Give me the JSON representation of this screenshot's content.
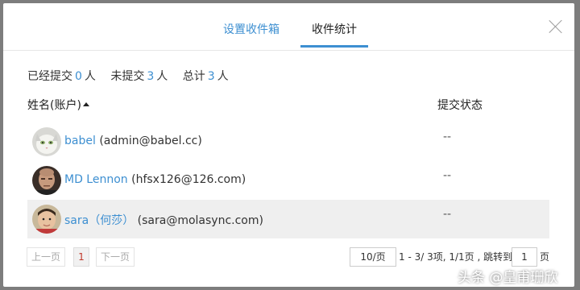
{
  "modal": {
    "tabs": [
      {
        "label": "设置收件箱",
        "active": false
      },
      {
        "label": "收件统计",
        "active": true
      }
    ]
  },
  "summary": {
    "submitted_label": "已经提交",
    "submitted_count": "0",
    "unsubmitted_label": "未提交",
    "unsubmitted_count": "3",
    "total_label": "总计",
    "total_count": "3",
    "unit": "人"
  },
  "table": {
    "headers": {
      "name": "姓名(账户)",
      "status": "提交状态"
    },
    "rows": [
      {
        "name": "babel",
        "account": "(admin@babel.cc)",
        "status": "--",
        "avatar": "cat-icon"
      },
      {
        "name": "MD Lennon",
        "account": "(hfsx126@126.com)",
        "status": "--",
        "avatar": "man-portrait-icon"
      },
      {
        "name": "sara（何莎）",
        "account": "(sara@molasync.com)",
        "status": "--",
        "avatar": "child-portrait-icon"
      }
    ]
  },
  "pagination": {
    "prev_label": "上一页",
    "current_page": "1",
    "next_label": "下一页",
    "page_size": "10/页",
    "info": "1 - 3/ 3项, 1/1页 , 跳转到",
    "jump_value": "1",
    "jump_unit": "页"
  },
  "watermark": "头条 @皇甫珊欣",
  "colors": {
    "accent": "#3d8fd1",
    "current_page": "#c0392b",
    "highlight_row": "#efefef"
  }
}
